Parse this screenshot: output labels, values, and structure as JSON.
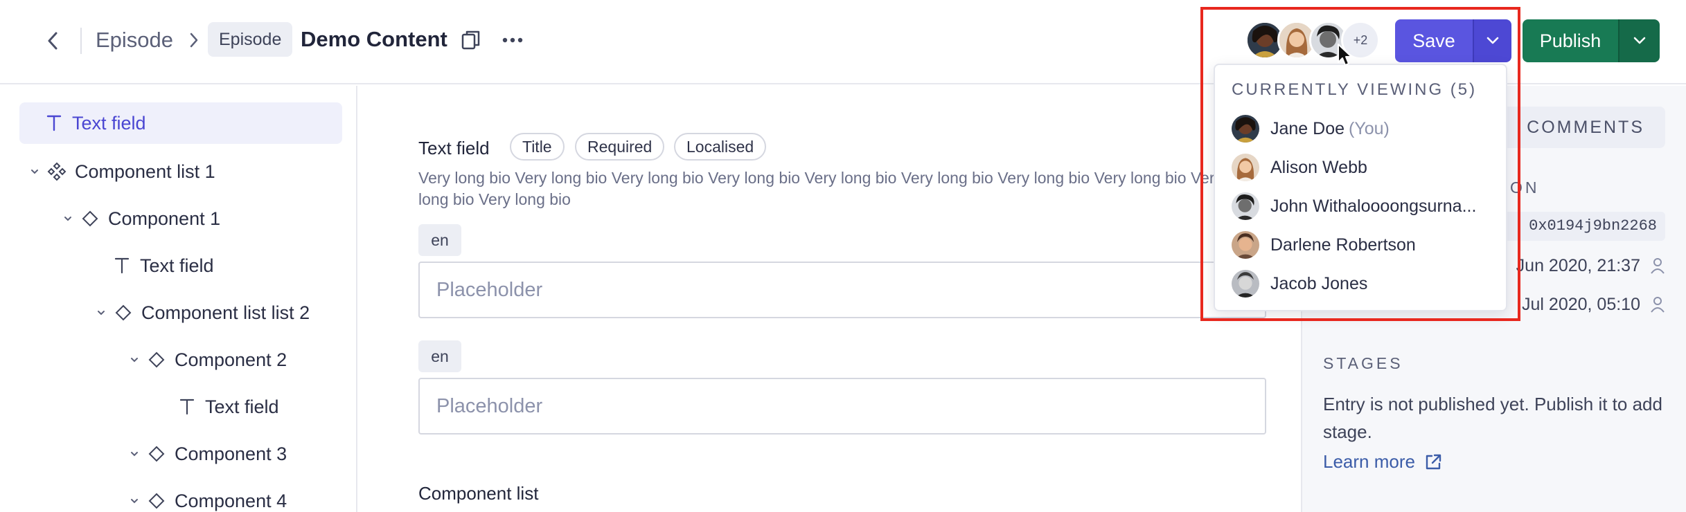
{
  "header": {
    "back_label": "Back",
    "breadcrumb_model": "Episode",
    "breadcrumb_badge": "Episode",
    "entry_title": "Demo Content",
    "avatars_more": "+2",
    "save_label": "Save",
    "publish_label": "Publish"
  },
  "sidebar": {
    "items": [
      {
        "label": "Text field",
        "icon": "text-icon"
      },
      {
        "label": "Component list 1",
        "icon": "components-icon"
      },
      {
        "label": "Component 1",
        "icon": "component-icon"
      },
      {
        "label": "Text field",
        "icon": "text-icon"
      },
      {
        "label": "Component list list 2",
        "icon": "component-icon"
      },
      {
        "label": "Component 2",
        "icon": "component-icon"
      },
      {
        "label": "Text field",
        "icon": "text-icon"
      },
      {
        "label": "Component 3",
        "icon": "component-icon"
      },
      {
        "label": "Component 4",
        "icon": "component-icon"
      }
    ]
  },
  "main": {
    "field_label": "Text field",
    "tags": [
      "Title",
      "Required",
      "Localised"
    ],
    "description": "Very long bio Very long bio Very long bio Very long bio Very long bio Very long bio Very long bio Very long bio Very long bio Very long bio",
    "locales": [
      {
        "lang": "en",
        "placeholder": "Placeholder"
      },
      {
        "lang": "en",
        "placeholder": "Placeholder"
      }
    ],
    "component_list_label": "Component list"
  },
  "right_panel": {
    "comments_tab": "COMMENTS",
    "version_label": "ON",
    "version_code": "0x0194j9bn2268",
    "created_date": "Jun 2020, 21:37",
    "updated_date": "Jul 2020, 05:10",
    "stages_label": "STAGES",
    "stages_text": "Entry is not published yet. Publish it to add stage.",
    "learn_more": "Learn more"
  },
  "viewers": {
    "title": "CURRENTLY VIEWING (5)",
    "you_suffix": "(You)",
    "people": [
      {
        "name": "Jane Doe"
      },
      {
        "name": "Alison Webb"
      },
      {
        "name": "John Withaloooongsurna..."
      },
      {
        "name": "Darlene Robertson"
      },
      {
        "name": "Jacob Jones"
      }
    ]
  },
  "colors": {
    "accent": "#5a55e0",
    "publish": "#187a54",
    "highlight": "#e8281e"
  }
}
